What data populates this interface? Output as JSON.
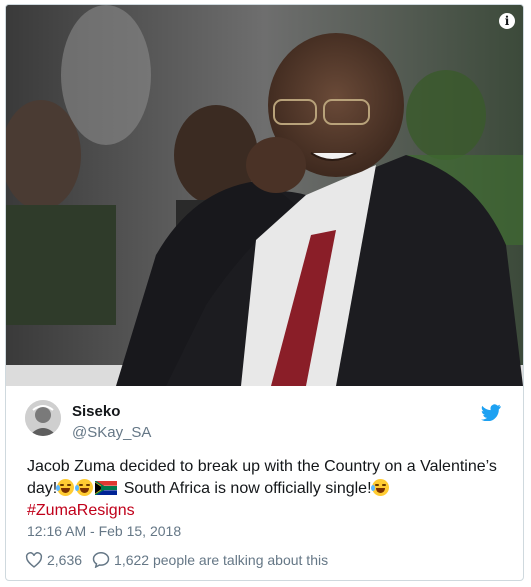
{
  "tweet": {
    "author_name": "Siseko",
    "author_handle": "@SKay_SA",
    "text_part1": "Jacob Zuma decided to break up with the Country on a Valentine’s day!",
    "text_part2": " South Africa is now officially single!",
    "hashtag": "#ZumaResigns",
    "timestamp": "12:16 AM - Feb 15, 2018",
    "likes": "2,636",
    "replies_text": "1,622 people are talking about this"
  },
  "icons": [
    "info-icon",
    "twitter-bird-icon",
    "heart-icon",
    "speech-bubble-icon",
    "rofl-emoji",
    "joy-emoji",
    "south-africa-flag-emoji"
  ],
  "colors": {
    "twitter_blue": "#1da1f2",
    "hashtag": "#c0001a",
    "secondary_text": "#657786",
    "border": "#cfd9de"
  }
}
